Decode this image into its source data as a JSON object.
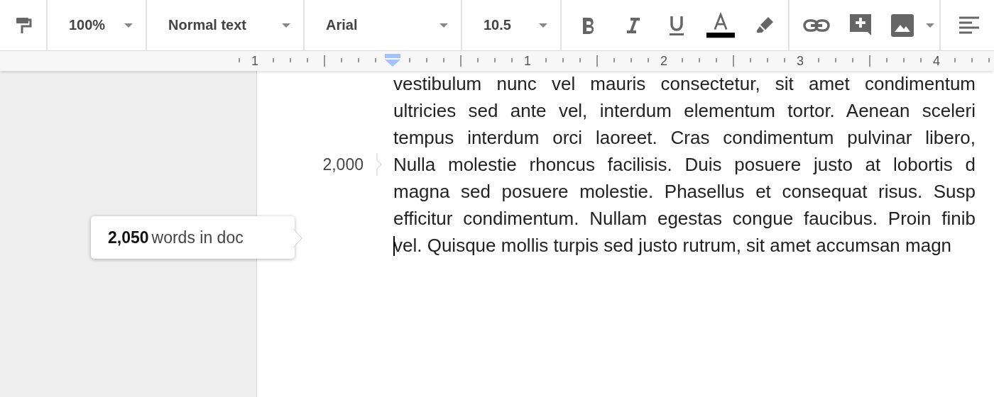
{
  "toolbar": {
    "dropdowns": [
      {
        "label": "100%"
      },
      {
        "label": "Normal text"
      },
      {
        "label": "Arial"
      },
      {
        "label": "10.5"
      }
    ]
  },
  "ruler": {
    "labels": [
      "1",
      "1",
      "2",
      "3",
      "4"
    ]
  },
  "document": {
    "lines": [
      {
        "text": "vestibulum nunc vel mauris consectetur, sit amet condimentum",
        "cursor": false
      },
      {
        "text": "ultricies sed ante vel, interdum elementum tortor. Aenean sceleri",
        "cursor": false
      },
      {
        "text": "tempus interdum orci laoreet. Cras condimentum pulvinar libero,",
        "cursor": false
      },
      {
        "text": "Nulla molestie rhoncus facilisis. Duis posuere justo at lobortis d",
        "word_count_marker": "2,000",
        "cursor": false
      },
      {
        "text": "magna sed posuere molestie. Phasellus et consequat risus. Susp",
        "cursor": false
      },
      {
        "text": "efficitur condimentum. Nullam egestas congue faucibus. Proin finib",
        "cursor": false
      },
      {
        "text": "vel. Quisque mollis turpis sed justo rutrum, sit amet accumsan magn",
        "cursor": true
      }
    ]
  },
  "tooltip": {
    "text": "**2,050** words in doc"
  }
}
